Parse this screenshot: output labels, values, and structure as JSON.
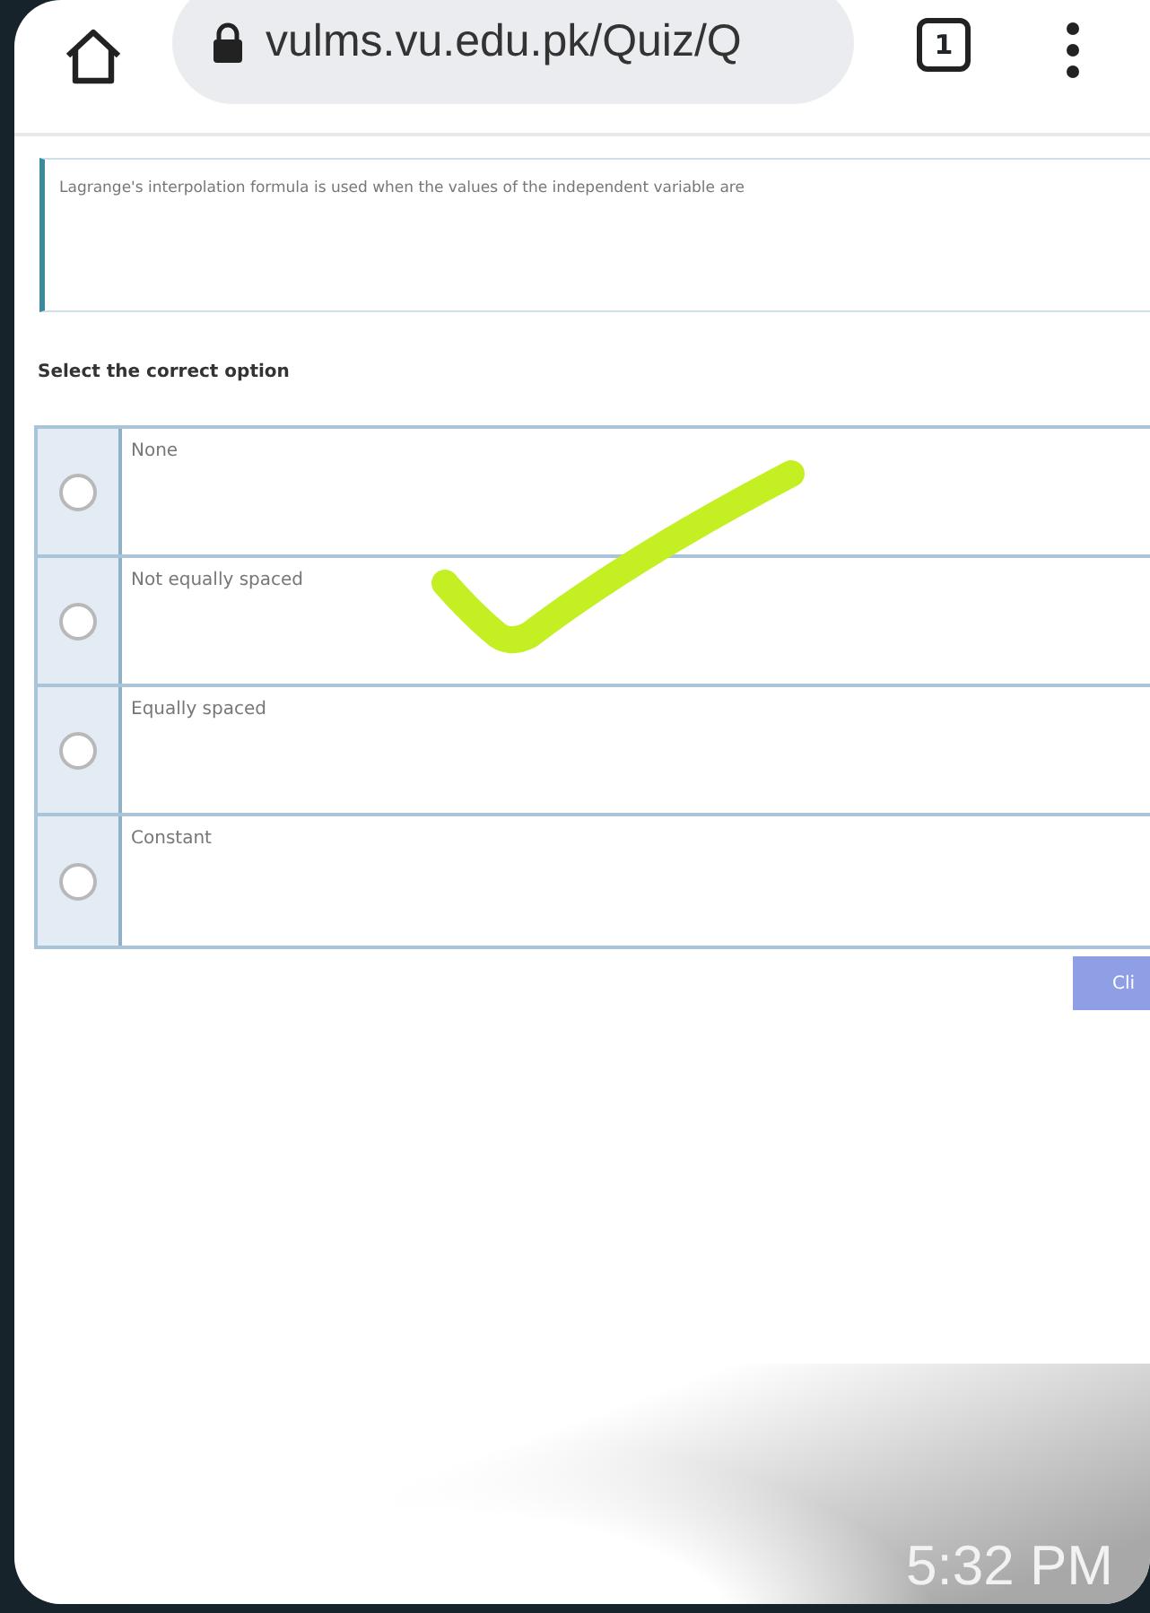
{
  "browser": {
    "url": "vulms.vu.edu.pk/Quiz/Q",
    "tab_count": "1"
  },
  "question": "Lagrange's interpolation formula is used when the values of the independent variable are",
  "instruction": "Select the correct option",
  "options": [
    {
      "label": "None",
      "selected": false
    },
    {
      "label": "Not equally spaced",
      "selected": false
    },
    {
      "label": "Equally spaced",
      "selected": false
    },
    {
      "label": "Constant",
      "selected": false
    }
  ],
  "button": "Cli",
  "timestamp": "5:32 PM"
}
